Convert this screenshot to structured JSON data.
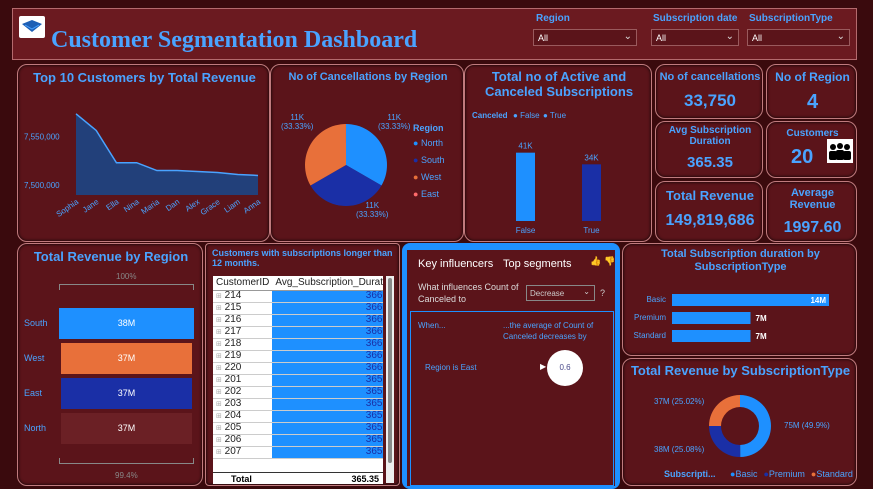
{
  "header": {
    "title": "Customer Segmentation Dashboard",
    "slicers": [
      {
        "label": "Region",
        "value": "All"
      },
      {
        "label": "Subscription date",
        "value": "All"
      },
      {
        "label": "SubscriptionType",
        "value": "All"
      }
    ]
  },
  "top10": {
    "title": "Top 10 Customers by Total Revenue",
    "yticks": [
      "7,550,000",
      "7,500,000"
    ],
    "chart_data": {
      "type": "area",
      "categories": [
        "Sophia",
        "Jane",
        "Ella",
        "Nina",
        "Maria",
        "Dan",
        "Alex",
        "Grace",
        "Liam",
        "Anna"
      ],
      "values": [
        7573000,
        7556000,
        7523000,
        7523000,
        7515000,
        7515000,
        7514000,
        7513000,
        7511000,
        7510000
      ],
      "ylim": [
        7490000,
        7580000
      ]
    }
  },
  "cancel_region": {
    "title": "No of Cancellations by Region",
    "legend_title": "Region",
    "chart_data": {
      "type": "pie",
      "categories": [
        "North",
        "South",
        "West",
        "East"
      ],
      "values": [
        33.33,
        33.33,
        33.33,
        0.01
      ],
      "colors": [
        "#1e90ff",
        "#1a2fa6",
        "#e8703a",
        "#ff6b6b"
      ]
    },
    "labels": {
      "tr": "11K\n(33.33%)",
      "tl": "11K\n(33.33%)",
      "b": "11K\n(33.33%)"
    }
  },
  "active_cancel": {
    "title": "Total no of Active and Canceled Subscriptions",
    "legend_title": "Canceled",
    "legend": [
      "False",
      "True"
    ],
    "chart_data": {
      "type": "bar",
      "categories": [
        "False",
        "True"
      ],
      "values": [
        41,
        34
      ],
      "data_labels": [
        "41K",
        "34K"
      ],
      "colors": [
        "#1e90ff",
        "#1a2fa6"
      ],
      "ylim": [
        0,
        45
      ]
    }
  },
  "kpis": {
    "cancellations": {
      "label": "No of cancellations",
      "value": "33,750"
    },
    "regions": {
      "label": "No of Region",
      "value": "4"
    },
    "avg_dur": {
      "label": "Avg Subscription Duration",
      "value": "365.35"
    },
    "customers": {
      "label": "Customers",
      "value": "20"
    },
    "total_rev": {
      "label": "Total Revenue",
      "value": "149,819,686"
    },
    "avg_rev": {
      "label": "Average Revenue",
      "value": "1997.60"
    }
  },
  "rev_region": {
    "title": "Total Revenue by Region",
    "top_pct": "100%",
    "bottom_pct": "99.4%",
    "chart_data": {
      "type": "bar",
      "categories": [
        "South",
        "West",
        "East",
        "North"
      ],
      "values": [
        38,
        37,
        37,
        37
      ],
      "data_labels": [
        "38M",
        "37M",
        "37M",
        "37M"
      ],
      "colors": [
        "#1e90ff",
        "#e8703a",
        "#1a2fa6",
        "#6b2025"
      ]
    }
  },
  "table": {
    "title": "Customers with subscriptions longer than 12 months.",
    "col1": "CustomerID",
    "col2": "Avg_Subscription_Duration",
    "rows": [
      [
        "214",
        "366.00"
      ],
      [
        "215",
        "366.00"
      ],
      [
        "216",
        "366.00"
      ],
      [
        "217",
        "366.00"
      ],
      [
        "218",
        "366.00"
      ],
      [
        "219",
        "366.00"
      ],
      [
        "220",
        "366.00"
      ],
      [
        "201",
        "365.00"
      ],
      [
        "202",
        "365.00"
      ],
      [
        "203",
        "365.00"
      ],
      [
        "204",
        "365.00"
      ],
      [
        "205",
        "365.00"
      ],
      [
        "206",
        "365.00"
      ],
      [
        "207",
        "365.00"
      ]
    ],
    "total_label": "Total",
    "total_value": "365.35"
  },
  "influencers": {
    "tab1": "Key influencers",
    "tab2": "Top segments",
    "question": "What influences Count of Canceled to",
    "dropdown": "Decrease",
    "when": "When...",
    "avg_text": "...the average of Count of Canceled decreases by",
    "factor": "Region is East",
    "factor_value": "0.6"
  },
  "dur_type": {
    "title": "Total Subscription duration by SubscriptionType",
    "chart_data": {
      "type": "bar",
      "categories": [
        "Basic",
        "Premium",
        "Standard"
      ],
      "values": [
        14,
        7,
        7
      ],
      "data_labels": [
        "14M",
        "7M",
        "7M"
      ],
      "xlim": [
        0,
        14
      ]
    }
  },
  "rev_type": {
    "title": "Total Revenue by SubscriptionType",
    "legend_title": "Subscripti...",
    "chart_data": {
      "type": "pie",
      "categories": [
        "Basic",
        "Premium",
        "Standard"
      ],
      "values": [
        49.9,
        25.08,
        25.02
      ],
      "colors": [
        "#1e90ff",
        "#1a2fa6",
        "#e8703a"
      ]
    },
    "labels": {
      "basic": "75M (49.9%)",
      "premium": "38M (25.08%)",
      "standard": "37M (25.02%)"
    }
  }
}
